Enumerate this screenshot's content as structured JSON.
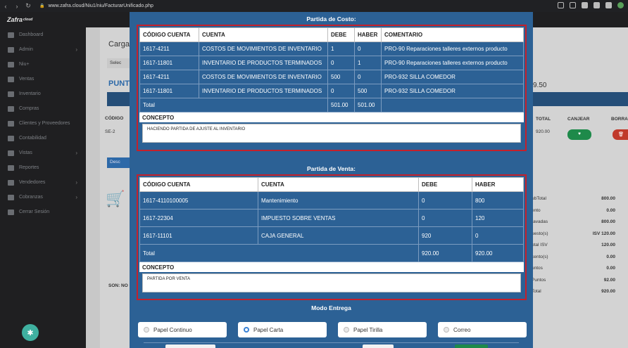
{
  "browser": {
    "url": "www.zafra.cloud/Niu1/niu/FacturarUnificado.php"
  },
  "sidebar": {
    "brand": "Zafra",
    "brand_suffix": "cloud",
    "items": [
      {
        "label": "Dashboard",
        "icon": "dashboard-icon",
        "chevron": false
      },
      {
        "label": "Admin",
        "icon": "wrench-icon",
        "chevron": true
      },
      {
        "label": "Niu+",
        "icon": "box-icon",
        "chevron": false
      },
      {
        "label": "Ventas",
        "icon": "video-icon",
        "chevron": false
      },
      {
        "label": "Inventario",
        "icon": "inventory-icon",
        "chevron": false
      },
      {
        "label": "Compras",
        "icon": "cart-icon",
        "chevron": false
      },
      {
        "label": "Clientes y Proveedores",
        "icon": "users-icon",
        "chevron": false
      },
      {
        "label": "Contabilidad",
        "icon": "database-icon",
        "chevron": false
      },
      {
        "label": "Vistas",
        "icon": "edit-icon",
        "chevron": true
      },
      {
        "label": "Reportes",
        "icon": "report-icon",
        "chevron": false
      },
      {
        "label": "Vendedores",
        "icon": "users-icon",
        "chevron": true
      },
      {
        "label": "Cobranzas",
        "icon": "edit-icon",
        "chevron": true
      },
      {
        "label": "Cerrar Sesión",
        "icon": "logout-icon",
        "chevron": false
      }
    ]
  },
  "background": {
    "carga": "Carga",
    "select": "Selec",
    "punto": "PUNTO",
    "codigo": "CÓDIGO",
    "se": "SE-2",
    "desc": "Desc",
    "son": "SON: NO",
    "total_hdr": "TOTAL",
    "canjear_hdr": "CANJEAR",
    "borrar_hdr": "BORRA",
    "amount_950": "9.50",
    "row_total": "920.00",
    "summary": [
      {
        "label": "ubTotal",
        "value": "800.00"
      },
      {
        "label": "ento",
        "value": "0.00"
      },
      {
        "label": "ravadas",
        "value": "800.00"
      },
      {
        "label": "uesto(s)",
        "value": "ISV 120.00"
      },
      {
        "label": "otal ISV",
        "value": "120.00"
      },
      {
        "label": "cento(s)",
        "value": "0.00"
      },
      {
        "label": "untos",
        "value": "0.00"
      },
      {
        "label": "Puntos",
        "value": "92.00"
      },
      {
        "label": "Total",
        "value": "920.00"
      }
    ]
  },
  "costo": {
    "title": "Partida de Costo:",
    "headers": [
      "CÓDIGO CUENTA",
      "CUENTA",
      "DEBE",
      "HABER",
      "COMENTARIO"
    ],
    "rows": [
      [
        "1617-4211",
        "COSTOS DE MOVIMIENTOS DE INVENTARIO",
        "1",
        "0",
        "PRO-90 Reparaciones talleres externos producto"
      ],
      [
        "1617-11801",
        "INVENTARIO DE PRODUCTOS TERMINADOS",
        "0",
        "1",
        "PRO-90 Reparaciones talleres externos producto"
      ],
      [
        "1617-4211",
        "COSTOS DE MOVIMIENTOS DE INVENTARIO",
        "500",
        "0",
        "PRO-932 SILLA COMEDOR"
      ],
      [
        "1617-11801",
        "INVENTARIO DE PRODUCTOS TERMINADOS",
        "0",
        "500",
        "PRO-932 SILLA COMEDOR"
      ]
    ],
    "total_label": "Total",
    "total_debe": "501.00",
    "total_haber": "501.00",
    "concepto_label": "CONCEPTO",
    "concepto_value": "HACIENDO PARTIDA DE AJUSTE AL INVENTARIO"
  },
  "venta": {
    "title": "Partida de Venta:",
    "headers": [
      "CÓDIGO CUENTA",
      "CUENTA",
      "DEBE",
      "HABER"
    ],
    "rows": [
      [
        "1617-4110100005",
        "Mantenimiento",
        "0",
        "800"
      ],
      [
        "1617-22304",
        "IMPUESTO SOBRE VENTAS",
        "0",
        "120"
      ],
      [
        "1617-11101",
        "CAJA GENERAL",
        "920",
        "0"
      ]
    ],
    "total_label": "Total",
    "total_debe": "920.00",
    "total_haber": "920.00",
    "concepto_label": "CONCEPTO",
    "concepto_value": "PARTIDA POR VENTA"
  },
  "modo": {
    "title": "Modo Entrega",
    "options": [
      {
        "label": "Papel Continuo",
        "selected": false
      },
      {
        "label": "Papel Carta",
        "selected": true
      },
      {
        "label": "Papel Tirilla",
        "selected": false
      },
      {
        "label": "Correo",
        "selected": false
      }
    ]
  },
  "colors": {
    "modal_bg": "#2c6195",
    "highlight_border": "#c4202b",
    "canjear_btn": "#1e8a4a",
    "borrar_btn": "#c0392b"
  }
}
